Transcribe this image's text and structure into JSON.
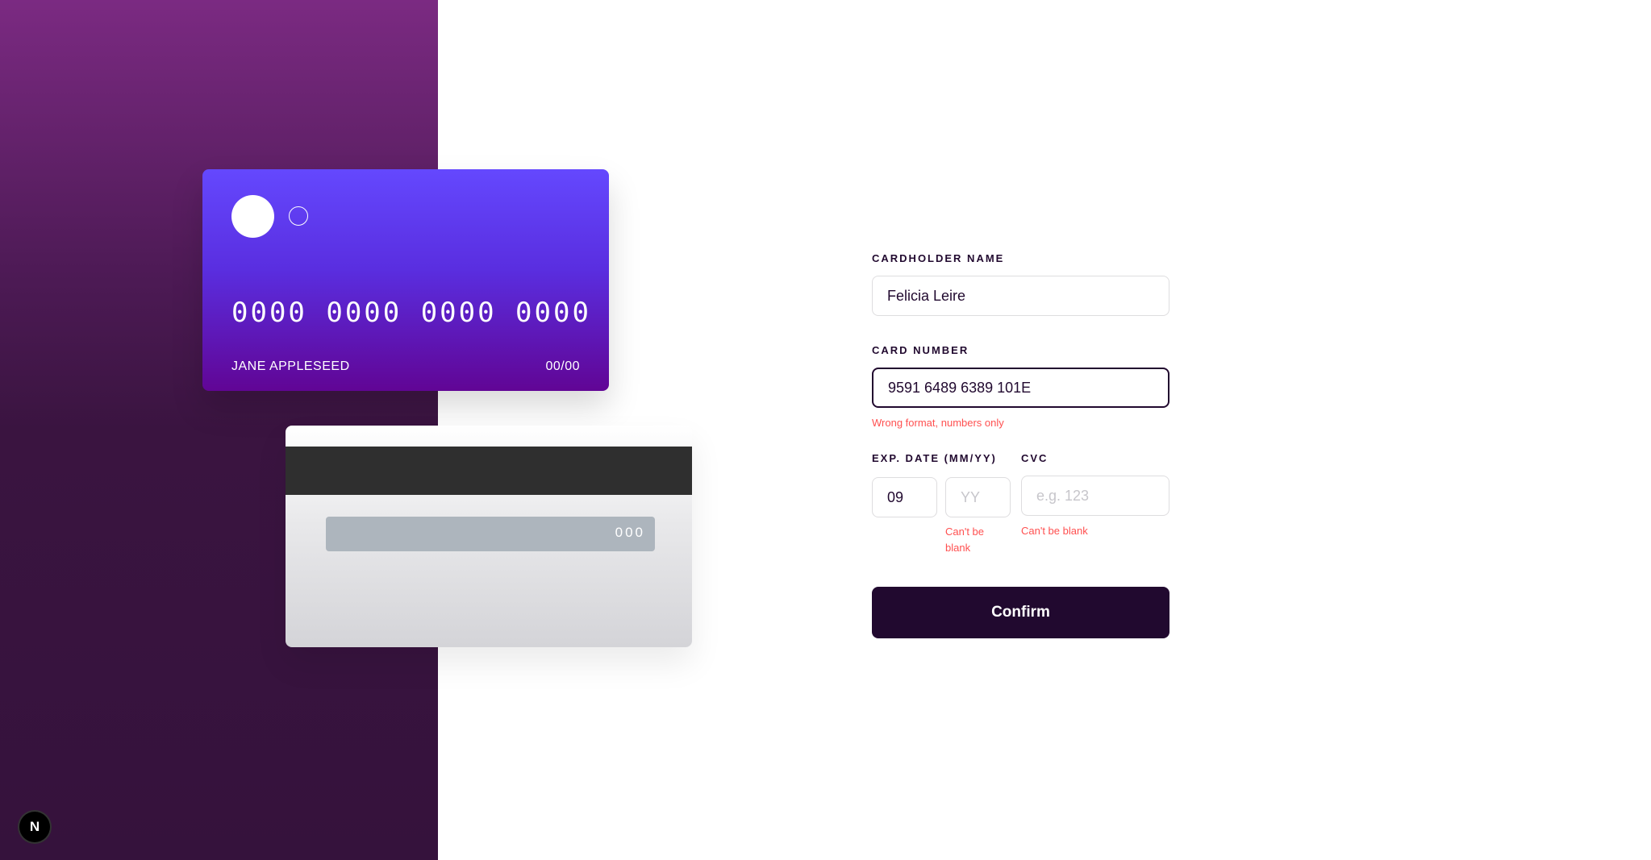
{
  "card_front": {
    "number": "0000 0000 0000 0000",
    "name": "JANE APPLESEED",
    "exp": "00/00"
  },
  "card_back": {
    "cvc": "000"
  },
  "form": {
    "name_label": "Cardholder Name",
    "name_value": "Felicia Leire",
    "number_label": "Card Number",
    "number_value": "9591 6489 6389 101E",
    "number_error": "Wrong format, numbers only",
    "exp_label": "Exp. Date (MM/YY)",
    "exp_month_value": "09",
    "exp_year_placeholder": "YY",
    "exp_error": "Can't be blank",
    "cvc_label": "CVC",
    "cvc_placeholder": "e.g. 123",
    "cvc_error": "Can't be blank",
    "confirm_label": "Confirm"
  },
  "devtools": {
    "badge": "N"
  },
  "colors": {
    "accent": "#21092f",
    "error": "#ff5050",
    "card_gradient_start": "#6448fe",
    "card_gradient_end": "#610595"
  }
}
